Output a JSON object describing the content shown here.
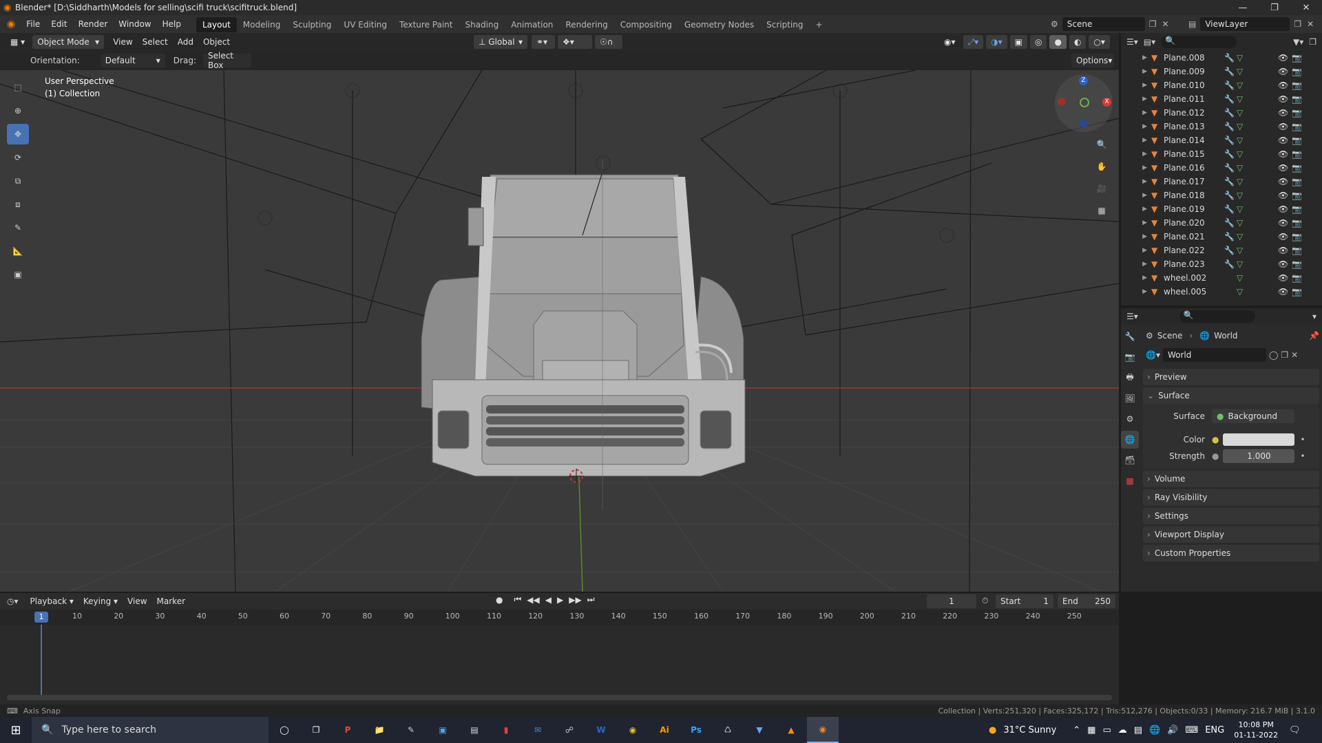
{
  "window": {
    "title": "Blender* [D:\\Siddharth\\Models for selling\\scifi truck\\scifitruck.blend]",
    "controls": [
      "minimize",
      "restore",
      "close"
    ]
  },
  "menubar": {
    "menus": [
      "File",
      "Edit",
      "Render",
      "Window",
      "Help"
    ],
    "workspaces": [
      "Layout",
      "Modeling",
      "Sculpting",
      "UV Editing",
      "Texture Paint",
      "Shading",
      "Animation",
      "Rendering",
      "Compositing",
      "Geometry Nodes",
      "Scripting"
    ],
    "add_tab": "+",
    "scene": "Scene",
    "view_layer": "ViewLayer"
  },
  "viewport_header": {
    "mode": "Object Mode",
    "menus": [
      "View",
      "Select",
      "Add",
      "Object"
    ],
    "transform_orientation": "Global",
    "orientation_label": "Orientation:",
    "orientation_value": "Default",
    "drag_label": "Drag:",
    "drag_value": "Select Box",
    "options": "Options"
  },
  "viewport": {
    "view_name": "User Perspective",
    "collection": "(1) Collection",
    "gizmo": {
      "z": "Z",
      "x": "X",
      "y": "Y"
    }
  },
  "outliner": {
    "items": [
      {
        "name": "Plane.008",
        "has_modifier": true
      },
      {
        "name": "Plane.009",
        "has_modifier": true
      },
      {
        "name": "Plane.010",
        "has_modifier": true
      },
      {
        "name": "Plane.011",
        "has_modifier": true
      },
      {
        "name": "Plane.012",
        "has_modifier": true
      },
      {
        "name": "Plane.013",
        "has_modifier": true
      },
      {
        "name": "Plane.014",
        "has_modifier": true
      },
      {
        "name": "Plane.015",
        "has_modifier": true
      },
      {
        "name": "Plane.016",
        "has_modifier": true
      },
      {
        "name": "Plane.017",
        "has_modifier": true
      },
      {
        "name": "Plane.018",
        "has_modifier": true
      },
      {
        "name": "Plane.019",
        "has_modifier": true
      },
      {
        "name": "Plane.020",
        "has_modifier": true
      },
      {
        "name": "Plane.021",
        "has_modifier": true
      },
      {
        "name": "Plane.022",
        "has_modifier": true
      },
      {
        "name": "Plane.023",
        "has_modifier": true
      },
      {
        "name": "wheel.002",
        "has_modifier": false
      },
      {
        "name": "wheel.005",
        "has_modifier": false
      }
    ]
  },
  "properties": {
    "breadcrumb_scene": "Scene",
    "breadcrumb_world": "World",
    "world_name": "World",
    "panels": {
      "preview": "Preview",
      "surface": "Surface",
      "volume": "Volume",
      "ray_visibility": "Ray Visibility",
      "settings": "Settings",
      "viewport_display": "Viewport Display",
      "custom_properties": "Custom Properties"
    },
    "surface_label": "Surface",
    "surface_value": "Background",
    "color_label": "Color",
    "strength_label": "Strength",
    "strength_value": "1.000"
  },
  "timeline": {
    "menus": [
      "Playback",
      "Keying",
      "View",
      "Marker"
    ],
    "current_frame": "1",
    "start_label": "Start",
    "start_value": "1",
    "end_label": "End",
    "end_value": "250",
    "ruler": [
      "10",
      "20",
      "30",
      "40",
      "50",
      "60",
      "70",
      "80",
      "90",
      "100",
      "110",
      "120",
      "130",
      "140",
      "150",
      "160",
      "170",
      "180",
      "190",
      "200",
      "210",
      "220",
      "230",
      "240",
      "250"
    ],
    "playhead_label": "1"
  },
  "statusbar": {
    "left": "Axis Snap",
    "right": "Collection | Verts:251,320 | Faces:325,172 | Tris:512,276 | Objects:0/33 | Memory: 216.7 MiB | 3.1.0"
  },
  "taskbar": {
    "search_placeholder": "Type here to search",
    "weather": "31°C  Sunny",
    "language": "ENG",
    "time": "10:08 PM",
    "date": "01-11-2022"
  },
  "colors": {
    "accent": "#4772b3",
    "outliner_icon": "#e8833a",
    "mesh_icon": "#6fbf6f"
  }
}
